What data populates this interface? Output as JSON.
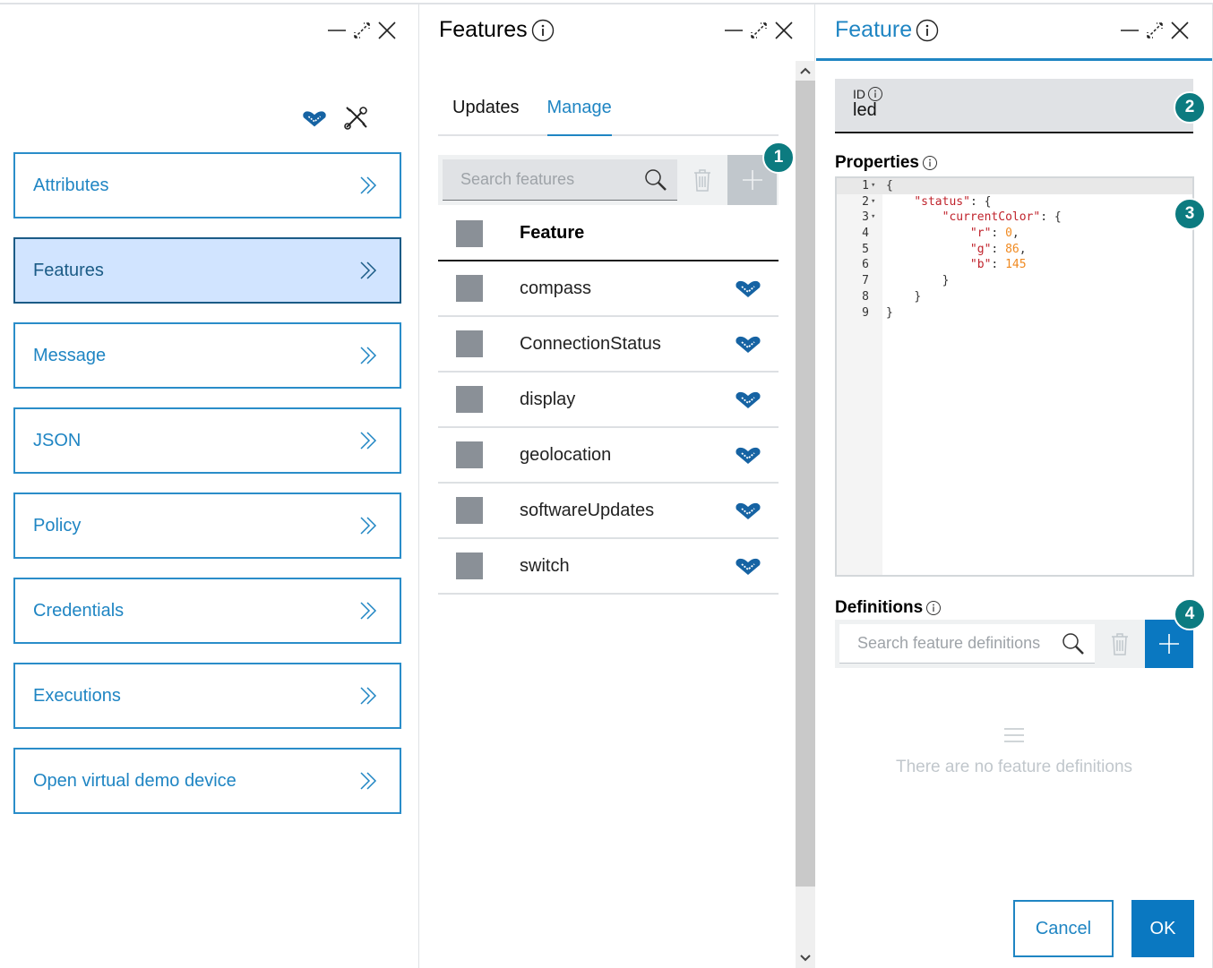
{
  "panels": {
    "left": {
      "items": [
        {
          "label": "Attributes",
          "active": false
        },
        {
          "label": "Features",
          "active": true
        },
        {
          "label": "Message",
          "active": false
        },
        {
          "label": "JSON",
          "active": false
        },
        {
          "label": "Policy",
          "active": false
        },
        {
          "label": "Credentials",
          "active": false
        },
        {
          "label": "Executions",
          "active": false
        },
        {
          "label": "Open virtual demo device",
          "active": false
        }
      ]
    },
    "features": {
      "title": "Features",
      "tabs": [
        {
          "label": "Updates",
          "active": false
        },
        {
          "label": "Manage",
          "active": true
        }
      ],
      "search_placeholder": "Search features",
      "column_header": "Feature",
      "rows": [
        "compass",
        "ConnectionStatus",
        "display",
        "geolocation",
        "softwareUpdates",
        "switch"
      ],
      "badge": "1"
    },
    "feature": {
      "title": "Feature",
      "id_label": "ID",
      "id_value": "led",
      "id_badge": "2",
      "properties_label": "Properties",
      "properties_badge": "3",
      "properties_lines": [
        {
          "no": "1",
          "fold": true,
          "indent": "",
          "parts": [
            [
              "p",
              "{"
            ]
          ]
        },
        {
          "no": "2",
          "fold": true,
          "indent": "    ",
          "parts": [
            [
              "k",
              "\"status\""
            ],
            [
              "p",
              ": {"
            ]
          ]
        },
        {
          "no": "3",
          "fold": true,
          "indent": "        ",
          "parts": [
            [
              "k",
              "\"currentColor\""
            ],
            [
              "p",
              ": {"
            ]
          ]
        },
        {
          "no": "4",
          "fold": false,
          "indent": "            ",
          "parts": [
            [
              "k",
              "\"r\""
            ],
            [
              "p",
              ": "
            ],
            [
              "n",
              "0"
            ],
            [
              "p",
              ","
            ]
          ]
        },
        {
          "no": "5",
          "fold": false,
          "indent": "            ",
          "parts": [
            [
              "k",
              "\"g\""
            ],
            [
              "p",
              ": "
            ],
            [
              "n",
              "86"
            ],
            [
              "p",
              ","
            ]
          ]
        },
        {
          "no": "6",
          "fold": false,
          "indent": "            ",
          "parts": [
            [
              "k",
              "\"b\""
            ],
            [
              "p",
              ": "
            ],
            [
              "n",
              "145"
            ]
          ]
        },
        {
          "no": "7",
          "fold": false,
          "indent": "        ",
          "parts": [
            [
              "p",
              "}"
            ]
          ]
        },
        {
          "no": "8",
          "fold": false,
          "indent": "    ",
          "parts": [
            [
              "p",
              "}"
            ]
          ]
        },
        {
          "no": "9",
          "fold": false,
          "indent": "",
          "parts": [
            [
              "p",
              "}"
            ]
          ]
        }
      ],
      "definitions_label": "Definitions",
      "definitions_badge": "4",
      "definitions_search_placeholder": "Search feature definitions",
      "empty_text": "There are no feature definitions",
      "cancel_label": "Cancel",
      "ok_label": "OK"
    }
  },
  "colors": {
    "accent": "#1f85c3",
    "primary_button": "#0a78c1",
    "badge": "#0c7b80",
    "active_nav_bg": "#d1e4ff",
    "json_key": "#c0232c",
    "json_number": "#f08a21"
  }
}
